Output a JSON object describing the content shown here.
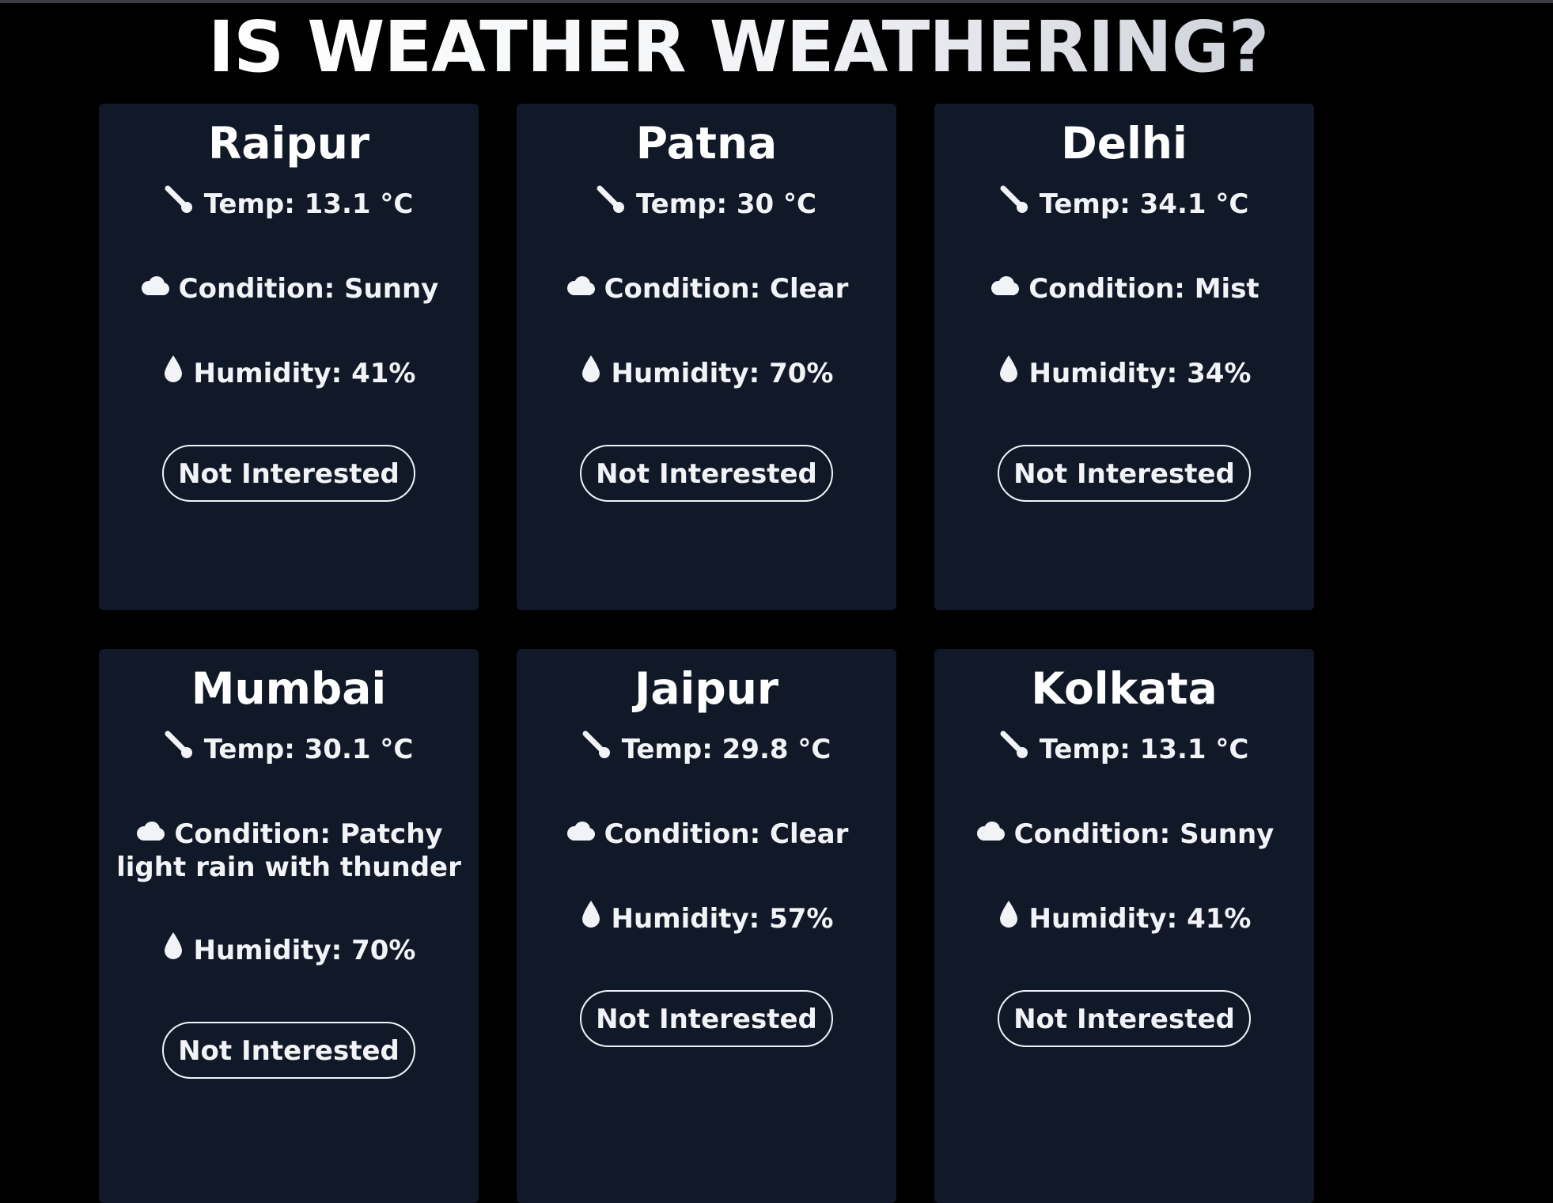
{
  "page": {
    "title": "IS WEATHER WEATHERING?"
  },
  "cities": [
    {
      "name": "Raipur",
      "temp": "Temp: 13.1 °C",
      "condition": "Condition: Sunny",
      "humidity": "Humidity: 41%",
      "button": "Not Interested"
    },
    {
      "name": "Patna",
      "temp": "Temp: 30 °C",
      "condition": "Condition: Clear",
      "humidity": "Humidity: 70%",
      "button": "Not Interested"
    },
    {
      "name": "Delhi",
      "temp": "Temp: 34.1 °C",
      "condition": "Condition: Mist",
      "humidity": "Humidity: 34%",
      "button": "Not Interested"
    },
    {
      "name": "Mumbai",
      "temp": "Temp: 30.1 °C",
      "condition": "Condition: Patchy light rain with thunder",
      "humidity": "Humidity: 70%",
      "button": "Not Interested"
    },
    {
      "name": "Jaipur",
      "temp": "Temp: 29.8 °C",
      "condition": "Condition: Clear",
      "humidity": "Humidity: 57%",
      "button": "Not Interested"
    },
    {
      "name": "Kolkata",
      "temp": "Temp: 13.1 °C",
      "condition": "Condition: Sunny",
      "humidity": "Humidity: 41%",
      "button": "Not Interested"
    }
  ],
  "icons": {
    "temp": "thermometer-icon",
    "condition": "cloud-icon",
    "humidity": "droplet-icon"
  },
  "colors": {
    "background": "#000000",
    "card": "#111827",
    "text": "#f1f3f7"
  }
}
